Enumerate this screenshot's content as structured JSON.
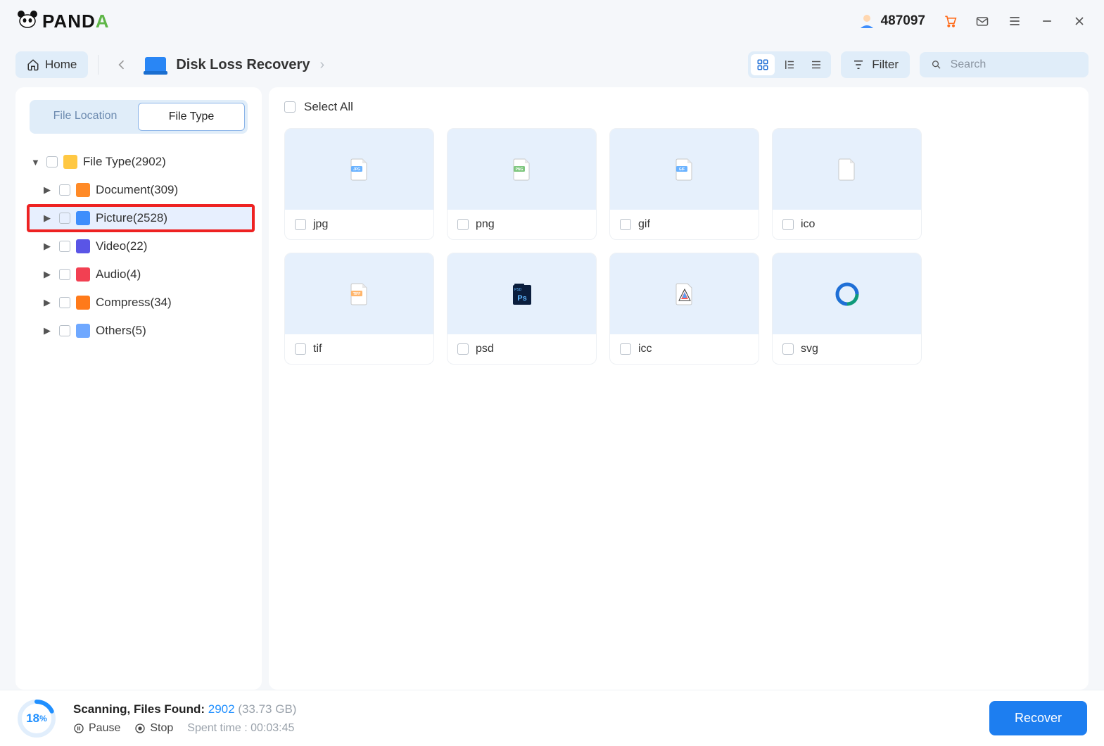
{
  "titlebar": {
    "logo_text": "PANDA",
    "user_id": "487097"
  },
  "toolbar": {
    "home_label": "Home",
    "breadcrumb": "Disk Loss Recovery",
    "filter_label": "Filter",
    "search_placeholder": "Search"
  },
  "sidebar": {
    "tabs": {
      "location": "File Location",
      "type": "File Type"
    },
    "root": {
      "label": "File Type(2902)"
    },
    "items": [
      {
        "label": "Document(309)",
        "icon": "ic-doc"
      },
      {
        "label": "Picture(2528)",
        "icon": "ic-pic",
        "selected": true,
        "highlighted": true
      },
      {
        "label": "Video(22)",
        "icon": "ic-vid"
      },
      {
        "label": "Audio(4)",
        "icon": "ic-aud"
      },
      {
        "label": "Compress(34)",
        "icon": "ic-zip"
      },
      {
        "label": "Others(5)",
        "icon": "ic-oth"
      }
    ]
  },
  "content": {
    "select_all": "Select All",
    "cards": [
      {
        "label": "jpg",
        "thumb": "jpg"
      },
      {
        "label": "png",
        "thumb": "png"
      },
      {
        "label": "gif",
        "thumb": "gif"
      },
      {
        "label": "ico",
        "thumb": "ico"
      },
      {
        "label": "tif",
        "thumb": "tif"
      },
      {
        "label": "psd",
        "thumb": "psd"
      },
      {
        "label": "icc",
        "thumb": "icc"
      },
      {
        "label": "svg",
        "thumb": "svg"
      }
    ]
  },
  "footer": {
    "progress_percent": "18",
    "progress_suffix": "%",
    "scanning_label": "Scanning, Files Found:",
    "found_count": "2902",
    "found_size": "(33.73 GB)",
    "pause_label": "Pause",
    "stop_label": "Stop",
    "spent_label": "Spent time : 00:03:45",
    "recover_label": "Recover"
  }
}
